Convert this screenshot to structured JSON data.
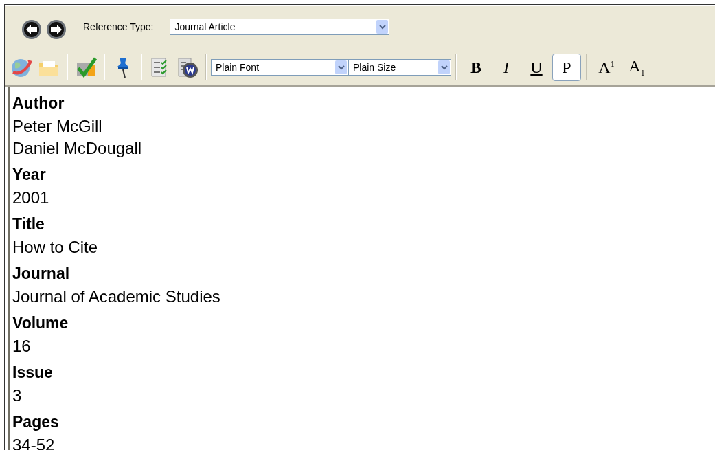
{
  "navigation": {
    "back": {
      "disabled": false
    },
    "forward": {
      "disabled": false
    }
  },
  "reference_type": {
    "label": "Reference Type:",
    "value": "Journal Article"
  },
  "toolbar": {
    "font": "Plain Font",
    "size": "Plain Size",
    "format_buttons": [
      {
        "kind": "bold",
        "label": "B",
        "selected": false
      },
      {
        "kind": "italic",
        "label": "I",
        "selected": false
      },
      {
        "kind": "underline",
        "label": "U",
        "selected": false
      },
      {
        "kind": "plain",
        "label": "P",
        "selected": true
      },
      {
        "kind": "superscript",
        "label": "A$^{1}$",
        "selected": false
      },
      {
        "kind": "subscript",
        "label": "A$_{1}$",
        "selected": false
      }
    ]
  },
  "fields": [
    {
      "label": "Author",
      "values": [
        "Peter McGill",
        "Daniel McDougall"
      ]
    },
    {
      "label": "Year",
      "values": [
        "2001"
      ]
    },
    {
      "label": "Title",
      "values": [
        "How to Cite"
      ]
    },
    {
      "label": "Journal",
      "values": [
        "Journal of Academic Studies"
      ]
    },
    {
      "label": "Volume",
      "values": [
        "16"
      ]
    },
    {
      "label": "Issue",
      "values": [
        "3"
      ]
    },
    {
      "label": "Pages",
      "values": [
        "34-52"
      ]
    }
  ]
}
